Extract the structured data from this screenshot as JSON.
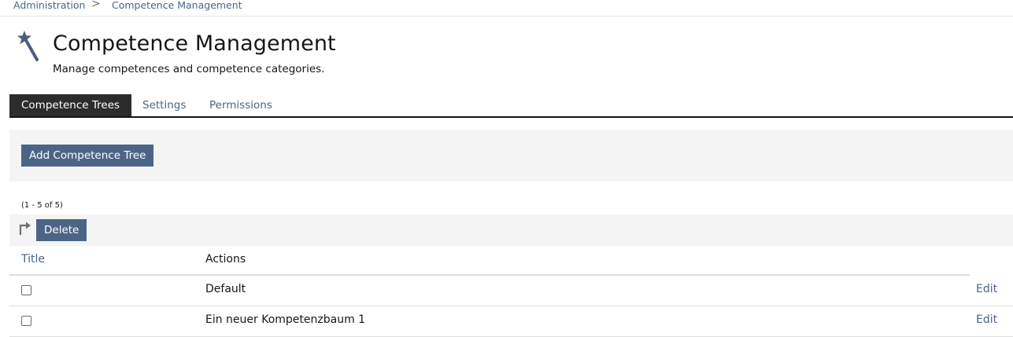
{
  "breadcrumb": {
    "items": [
      "Administration",
      "Competence Management"
    ],
    "separator": ">"
  },
  "header": {
    "icon": "magic-wand-icon",
    "title": "Competence Management",
    "description": "Manage competences and competence categories."
  },
  "tabs": [
    {
      "label": "Competence Trees",
      "active": true
    },
    {
      "label": "Settings",
      "active": false
    },
    {
      "label": "Permissions",
      "active": false
    }
  ],
  "toolbar": {
    "add_label": "Add Competence Tree"
  },
  "table": {
    "count": "(1 - 5 of 5)",
    "multi_icon": "select-arrow-icon",
    "delete_label": "Delete",
    "columns": [
      "Title",
      "Actions"
    ],
    "rows": [
      {
        "title": "Default",
        "action": "Edit",
        "checked": false
      },
      {
        "title": "Ein neuer Kompetenzbaum 1",
        "action": "Edit",
        "checked": false
      }
    ]
  },
  "colors": {
    "link": "#4c6586",
    "button_bg": "#4c6586",
    "active_tab_bg": "#2c2c2c",
    "panel_bg": "#f4f4f4"
  }
}
